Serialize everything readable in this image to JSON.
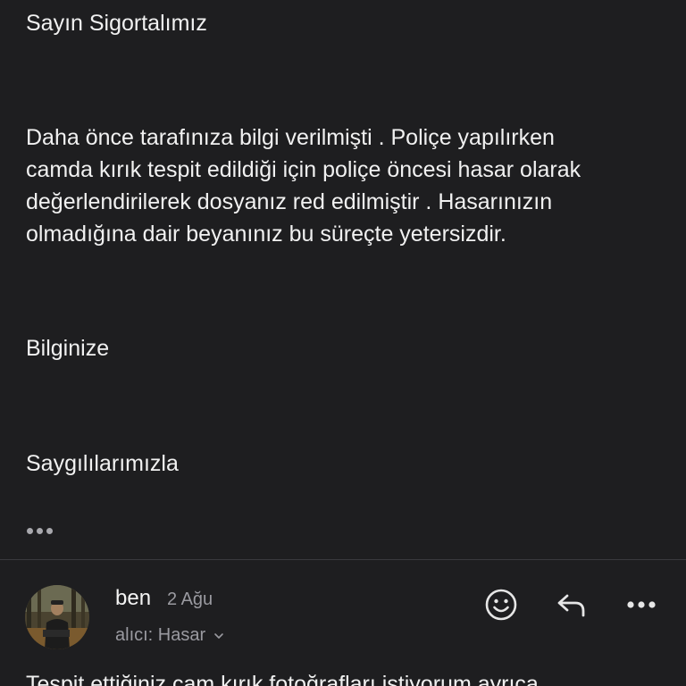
{
  "message": {
    "greeting": "Sayın Sigortalımız",
    "paragraph_lines": [
      "Daha önce tarafınıza bilgi verilmişti . Poliçe yapılırken",
      "camda kırık tespit edildiği için poliçe öncesi hasar olarak",
      "değerlendirilerek dosyanız red edilmiştir . Hasarınızın",
      "olmadığına dair beyanınız bu süreçte yetersizdir."
    ],
    "info": "Bilginize",
    "closing": "Saygılılarımızla"
  },
  "reply": {
    "sender": "ben",
    "date": "2 Ağu",
    "recipient": "alıcı: Hasar",
    "preview_line": "Tespit ettiğiniz cam kırık fotoğrafları istiyorum ayrıca"
  },
  "icons": {
    "more": "ellipsis-icon",
    "emoji": "smiley-icon",
    "reply": "reply-icon",
    "menu": "more-horizontal-icon",
    "recipient_toggle": "chevron-down-icon"
  },
  "colors": {
    "background": "#1e1e20",
    "text": "#f1f1f1",
    "secondary_text": "#9a9aa0",
    "divider": "#3a3a3e"
  }
}
